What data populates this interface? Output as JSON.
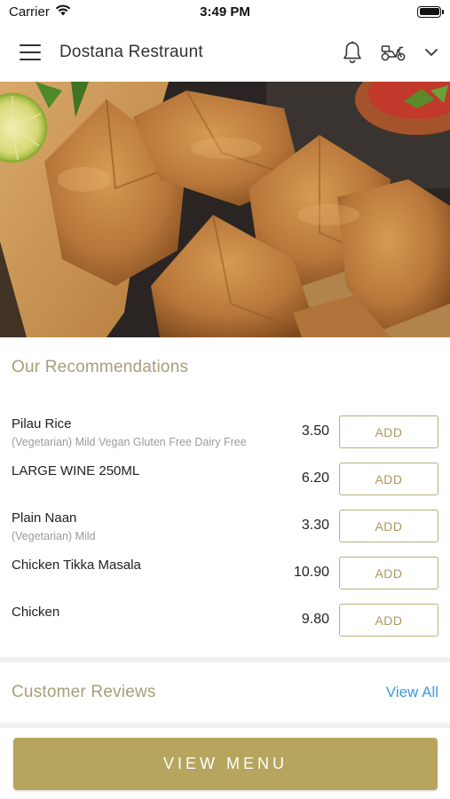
{
  "status_bar": {
    "carrier": "Carrier",
    "time": "3:49 PM",
    "battery_level": 1.0
  },
  "header": {
    "title": "Dostana Restraunt",
    "icons": [
      "menu-icon",
      "bell-icon",
      "scooter-icon",
      "chevron-down-icon"
    ]
  },
  "hero": {
    "image": "samosas-on-wooden-board-with-lime"
  },
  "recommendations": {
    "title": "Our Recommendations",
    "items": [
      {
        "name": "Pilau Rice",
        "description": "(Vegetarian) Mild  Vegan  Gluten Free  Dairy Free",
        "price": "3.50",
        "button": "ADD"
      },
      {
        "name": "LARGE WINE 250ML",
        "description": "",
        "price": "6.20",
        "button": "ADD"
      },
      {
        "name": "Plain Naan",
        "description": "(Vegetarian) Mild",
        "price": "3.30",
        "button": "ADD"
      },
      {
        "name": "Chicken Tikka Masala",
        "description": "",
        "price": "10.90",
        "button": "ADD"
      },
      {
        "name": "Chicken",
        "description": "",
        "price": "9.80",
        "button": "ADD"
      }
    ]
  },
  "reviews": {
    "title": "Customer Reviews",
    "view_all": "View All"
  },
  "bottom": {
    "view_menu": "VIEW MENU"
  },
  "colors": {
    "accent_gold": "#b5a55e",
    "section_title": "#a99d7a",
    "link_blue": "#3d9bd8"
  }
}
